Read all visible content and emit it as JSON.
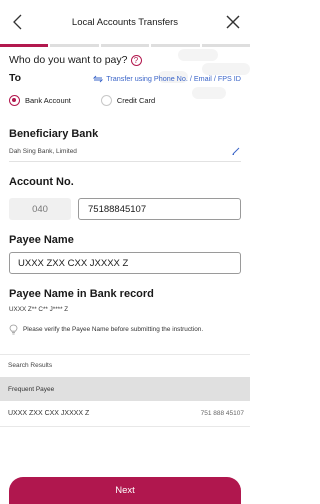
{
  "header": {
    "title": "Local Accounts Transfers",
    "back_icon": "chevron-left-icon",
    "close_icon": "close-icon"
  },
  "progress": {
    "steps": 5,
    "current_step": 1,
    "accent_color": "#b2184e"
  },
  "form": {
    "question": "Who do you want to pay?",
    "help_icon": "question-circle-icon",
    "to_label": "To",
    "transfer_link": "Transfer using Phone No. / Email / FPS ID",
    "transfer_link_icon": "swap-arrows-icon",
    "options": [
      {
        "label": "Bank Account",
        "selected": true
      },
      {
        "label": "Credit Card",
        "selected": false
      }
    ],
    "beneficiary_bank_label": "Beneficiary Bank",
    "beneficiary_bank_value": "Dah Sing Bank, Limited",
    "edit_icon": "pencil-icon",
    "account_no_label": "Account No.",
    "bank_code": "040",
    "account_number": "75188845107",
    "payee_name_label": "Payee Name",
    "payee_name_value": "UXXX ZXX CXX JXXXX Z",
    "payee_record_label": "Payee Name in Bank record",
    "payee_record_value": "UXXX Z** C** J**** Z",
    "verify_icon": "lightbulb-icon",
    "verify_note": "Please verify the Payee Name before submitting the instruction."
  },
  "results": {
    "search_results_label": "Search Results",
    "frequent_payee_label": "Frequent Payee",
    "payees": [
      {
        "name": "UXXX ZXX CXX JXXXX Z",
        "account": "751 888 45107"
      }
    ]
  },
  "footer": {
    "next_label": "Next"
  }
}
